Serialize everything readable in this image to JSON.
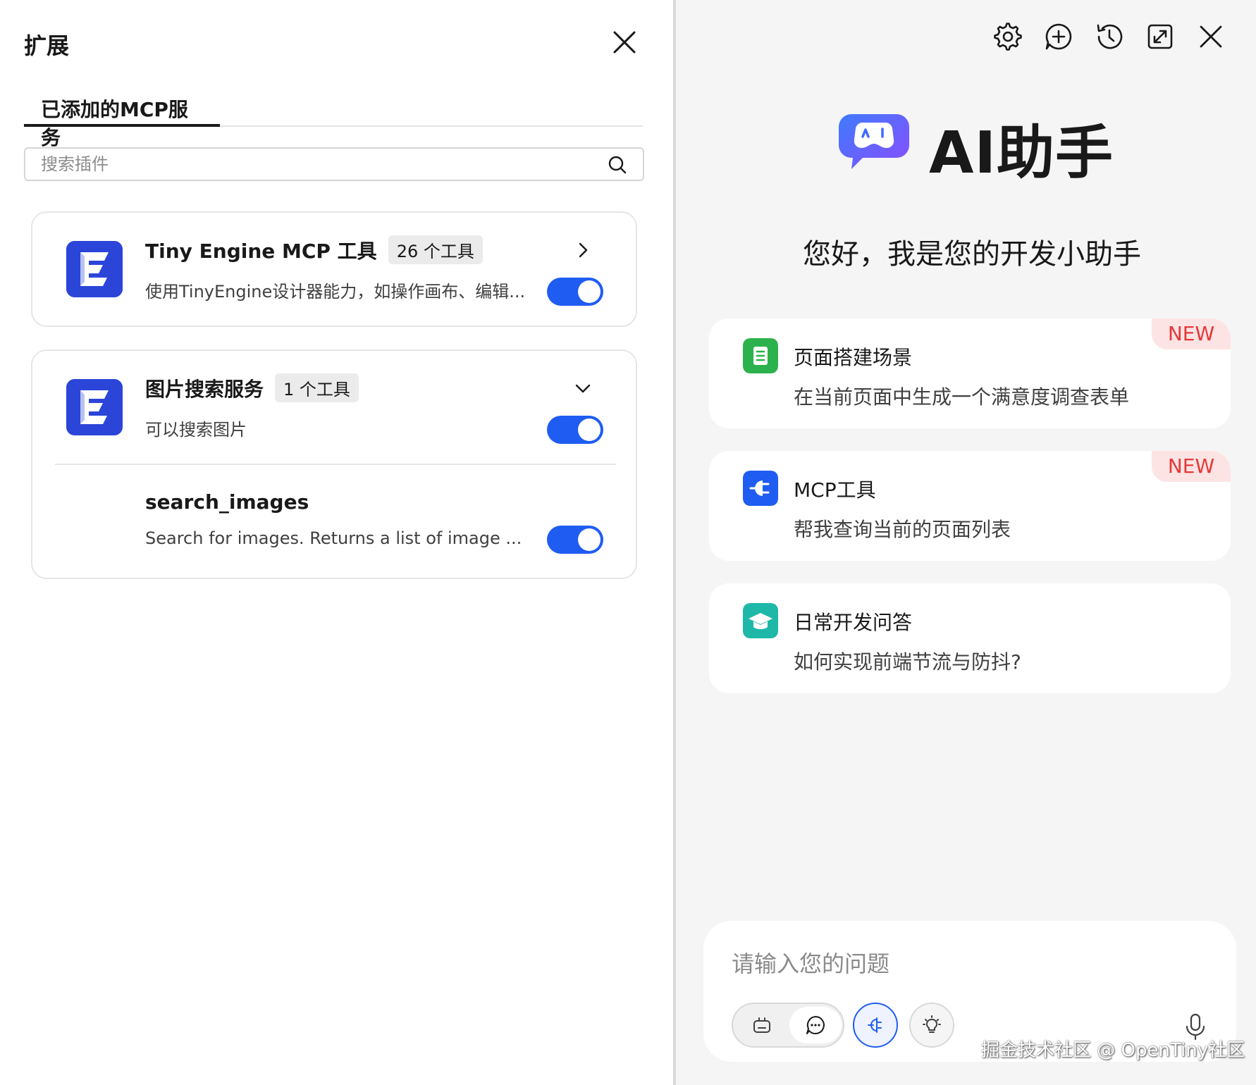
{
  "extensions_panel": {
    "title": "扩展",
    "tab_label": "已添加的MCP服务",
    "search_placeholder": "搜索插件",
    "services": [
      {
        "name": "Tiny Engine MCP 工具",
        "badge": "26 个工具",
        "description": "使用TinyEngine设计器能力，如操作画布、编辑...",
        "enabled": true,
        "expanded": false
      },
      {
        "name": "图片搜索服务",
        "badge": "1 个工具",
        "description": "可以搜索图片",
        "enabled": true,
        "expanded": true,
        "tools": [
          {
            "name": "search_images",
            "description": "Search for images. Returns a list of image ...",
            "enabled": true
          }
        ]
      }
    ]
  },
  "assistant": {
    "title": "AI助手",
    "greeting": "您好，我是您的开发小助手",
    "toolbar_icons": [
      "gear-icon",
      "new-chat-icon",
      "history-icon",
      "expand-icon",
      "close-icon"
    ],
    "scenarios": [
      {
        "title": "页面搭建场景",
        "subtitle": "在当前页面中生成一个满意度调查表单",
        "badge": "NEW",
        "icon_color": "#2bb24c"
      },
      {
        "title": "MCP工具",
        "subtitle": "帮我查询当前的页面列表",
        "badge": "NEW",
        "icon_color": "#1f5cf2"
      },
      {
        "title": "日常开发问答",
        "subtitle": "如何实现前端节流与防抖?",
        "icon_color": "#1fb8a8"
      }
    ],
    "input_placeholder": "请输入您的问题",
    "accent_color": "#1f5cf2"
  },
  "watermark": "掘金技术社区 @ OpenTiny社区"
}
